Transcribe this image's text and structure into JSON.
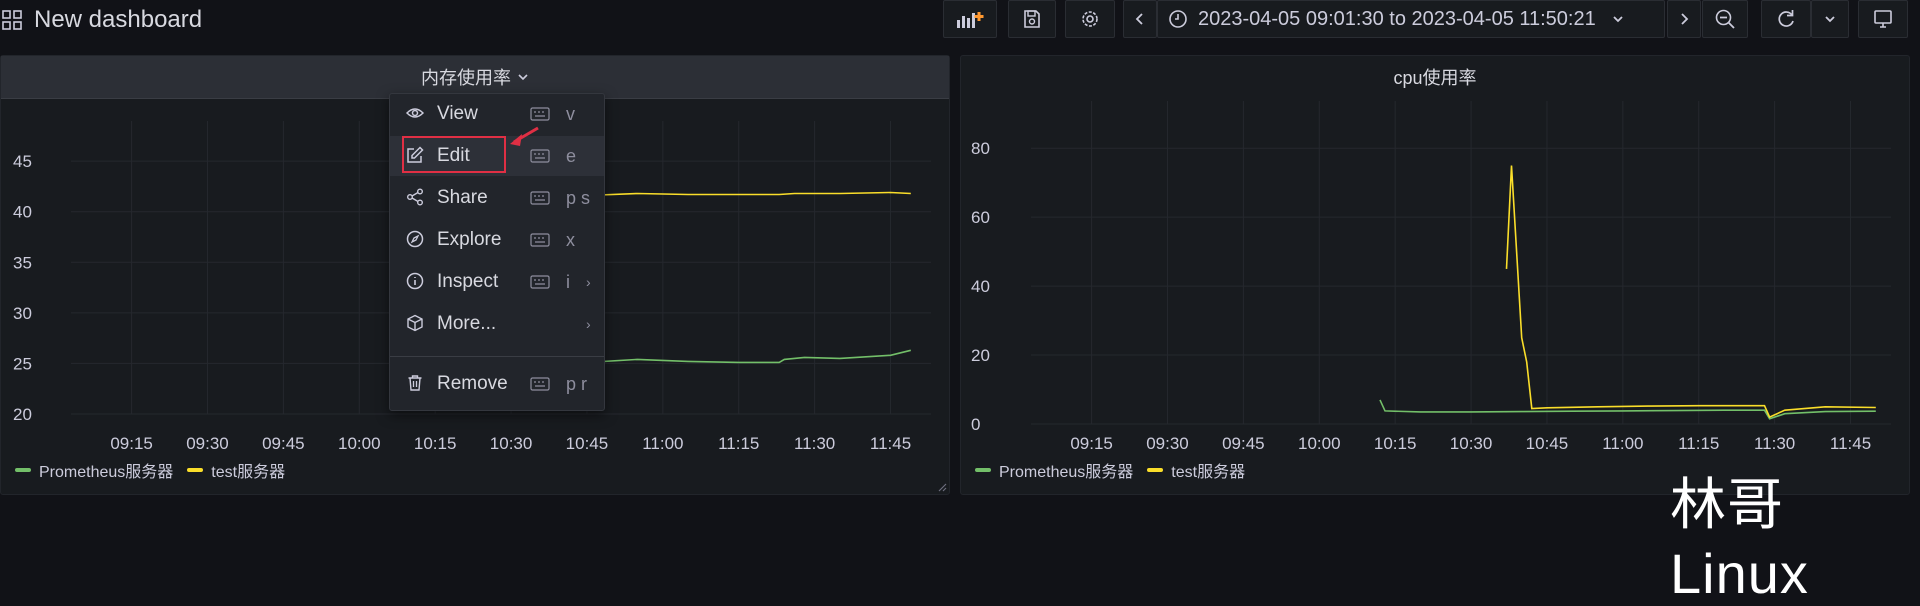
{
  "topbar": {
    "title": "New dashboard",
    "time_range": "2023-04-05 09:01:30 to 2023-04-05 11:50:21"
  },
  "panels": {
    "memory": {
      "title": "内存使用率",
      "y_ticks": [
        "45",
        "40",
        "35",
        "30",
        "25",
        "20"
      ],
      "x_ticks": [
        "09:15",
        "09:30",
        "09:45",
        "10:00",
        "10:15",
        "10:30",
        "10:45",
        "11:00",
        "11:15",
        "11:30",
        "11:45"
      ],
      "legend": [
        "Prometheus服务器",
        "test服务器"
      ]
    },
    "cpu": {
      "title": "cpu使用率",
      "y_ticks": [
        "80",
        "60",
        "40",
        "20",
        "0"
      ],
      "x_ticks": [
        "09:15",
        "09:30",
        "09:45",
        "10:00",
        "10:15",
        "10:30",
        "10:45",
        "11:00",
        "11:15",
        "11:30",
        "11:45"
      ],
      "legend": [
        "Prometheus服务器",
        "test服务器"
      ]
    }
  },
  "chart_data": [
    {
      "type": "line",
      "title": "内存使用率",
      "ylim": [
        20,
        46
      ],
      "x_range": [
        "09:05",
        "11:53"
      ],
      "legend_position": "bottom-left",
      "series": [
        {
          "name": "Prometheus服务器",
          "color": "#73bf69",
          "x": [
            "10:45",
            "10:55",
            "11:05",
            "11:15",
            "11:23",
            "11:24",
            "11:28",
            "11:35",
            "11:45",
            "11:49"
          ],
          "y": [
            25.1,
            25.4,
            25.2,
            25.1,
            25.1,
            25.4,
            25.6,
            25.5,
            25.8,
            26.3
          ]
        },
        {
          "name": "test服务器",
          "color": "#fade2a",
          "x": [
            "10:45",
            "10:55",
            "11:05",
            "11:15",
            "11:23",
            "11:26",
            "11:35",
            "11:45",
            "11:49"
          ],
          "y": [
            41.6,
            41.8,
            41.7,
            41.7,
            41.7,
            41.8,
            41.8,
            41.9,
            41.8
          ]
        }
      ]
    },
    {
      "type": "line",
      "title": "cpu使用率",
      "ylim": [
        0,
        85
      ],
      "x_range": [
        "09:05",
        "11:53"
      ],
      "legend_position": "bottom-left",
      "series": [
        {
          "name": "Prometheus服务器",
          "color": "#73bf69",
          "x": [
            "10:12",
            "10:13",
            "10:20",
            "10:30",
            "10:40",
            "10:50",
            "11:00",
            "11:10",
            "11:20",
            "11:28",
            "11:29",
            "11:32",
            "11:40",
            "11:50"
          ],
          "y": [
            7,
            3.8,
            3.5,
            3.5,
            3.6,
            3.7,
            3.8,
            3.9,
            4,
            4,
            1.5,
            3,
            3.6,
            3.7
          ]
        },
        {
          "name": "test服务器",
          "color": "#fade2a",
          "x": [
            "10:37",
            "10:38",
            "10:39",
            "10:40",
            "10:41",
            "10:42",
            "10:45",
            "10:55",
            "11:05",
            "11:15",
            "11:28",
            "11:29",
            "11:32",
            "11:40",
            "11:50"
          ],
          "y": [
            45,
            75,
            50,
            25,
            18,
            4.5,
            4.7,
            5,
            5.2,
            5.3,
            5.3,
            2,
            4,
            5,
            4.8
          ]
        }
      ]
    }
  ],
  "context_menu": {
    "items": [
      {
        "label": "View",
        "key": "v",
        "icon": "eye-icon"
      },
      {
        "label": "Edit",
        "key": "e",
        "icon": "edit-icon"
      },
      {
        "label": "Share",
        "key": "p s",
        "icon": "share-icon"
      },
      {
        "label": "Explore",
        "key": "x",
        "icon": "compass-icon"
      },
      {
        "label": "Inspect",
        "key": "i",
        "icon": "info-icon"
      },
      {
        "label": "More...",
        "key": "",
        "icon": "cube-icon"
      },
      {
        "label": "Remove",
        "key": "p r",
        "icon": "trash-icon"
      }
    ]
  },
  "watermark": "林哥Linux",
  "colors": {
    "accent_red": "#e02f44",
    "green": "#73bf69",
    "yellow": "#fade2a"
  }
}
